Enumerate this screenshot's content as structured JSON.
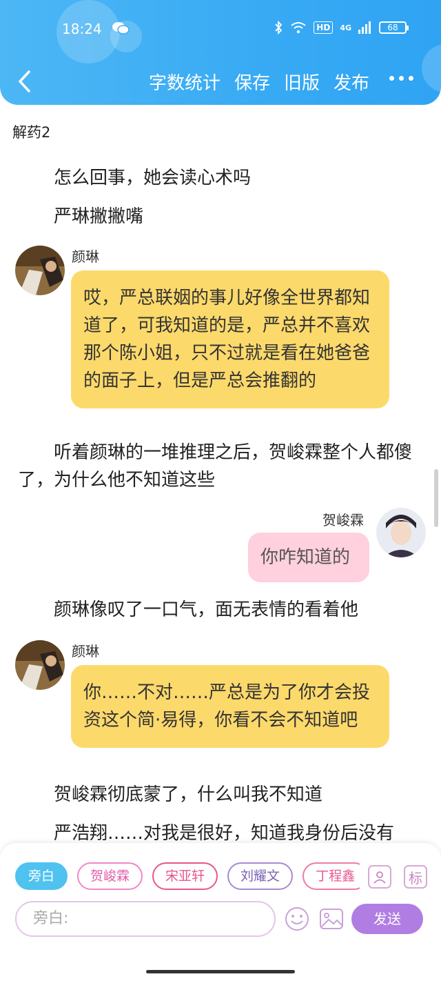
{
  "status_bar": {
    "time": "18:24",
    "hd": "HD",
    "network": "4G",
    "battery": "68"
  },
  "nav": {
    "actions": [
      "字数统计",
      "保存",
      "旧版",
      "发布"
    ]
  },
  "doc": {
    "title": "解药2",
    "items": [
      {
        "type": "para",
        "text": "怎么回事，她会读心术吗"
      },
      {
        "type": "para",
        "text": "严琳撇撇嘴"
      },
      {
        "type": "message",
        "speaker": "颜琳",
        "text": "哎，严总联姻的事儿好像全世界都知道了，可我知道的是，严总并不喜欢那个陈小姐，只不过就是看在她爸爸的面子上，但是严总会推翻的"
      },
      {
        "type": "para",
        "text": "听着颜琳的一堆推理之后，贺峻霖整个人都傻了，为什么他不知道这些"
      },
      {
        "type": "message",
        "speaker": "贺峻霖",
        "text": "你咋知道的"
      },
      {
        "type": "para",
        "text": "颜琳像叹了一口气，面无表情的看着他"
      },
      {
        "type": "message",
        "speaker": "颜琳",
        "text": "你……不对……严总是为了你才会投资这个简·易得，你看不会不知道吧"
      },
      {
        "type": "para",
        "text": "贺峻霖彻底蒙了，什么叫我不知道"
      },
      {
        "type": "para",
        "text": "严浩翔……对我是很好，知道我身份后没有"
      }
    ]
  },
  "composer": {
    "chips": [
      "旁白",
      "贺峻霖",
      "宋亚轩",
      "刘耀文",
      "丁程鑫"
    ],
    "mark_label": "标",
    "input_placeholder": "旁白:",
    "send_label": "发送"
  },
  "colors": {
    "header": "#38aaf4",
    "bubble_left": "#fcd96b",
    "bubble_right": "#ffd0dd",
    "send": "#b07ee2",
    "active_chip": "#4fc2f0"
  }
}
